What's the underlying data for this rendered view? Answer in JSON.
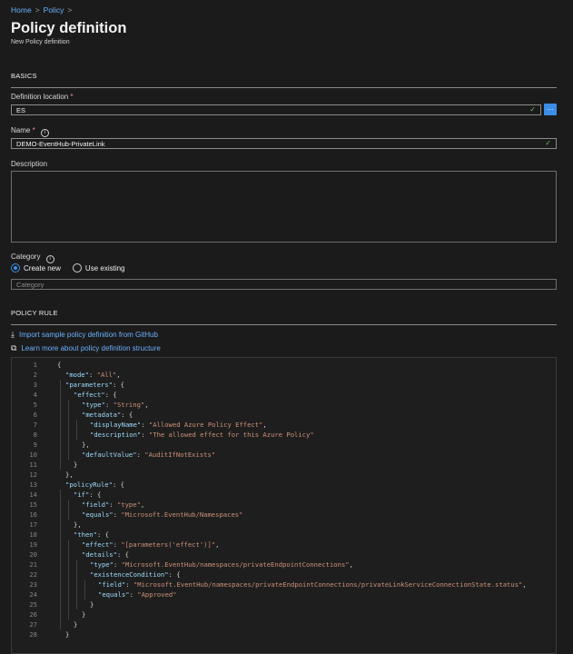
{
  "breadcrumb": {
    "home": "Home",
    "sep": ">",
    "policy": "Policy"
  },
  "header": {
    "title": "Policy definition",
    "subtitle": "New Policy definition"
  },
  "basics": {
    "section_title": "BASICS",
    "definition_location": {
      "label": "Definition location",
      "value": "ES",
      "browse_label": "..."
    },
    "name": {
      "label": "Name",
      "value": "DEMO-EventHub-PrivateLink",
      "info": "i"
    },
    "description": {
      "label": "Description",
      "value": ""
    },
    "category": {
      "label": "Category",
      "info": "i",
      "create_new": "Create new",
      "use_existing": "Use existing",
      "placeholder": "Category"
    }
  },
  "required_mark": "*",
  "valid_mark": "✓",
  "policy_rule": {
    "section_title": "POLICY RULE",
    "import_link": "Import sample policy definition from GitHub",
    "learn_link": "Learn more about policy definition structure"
  },
  "code": {
    "lines": [
      [
        [
          "p",
          "{"
        ]
      ],
      [
        [
          "k",
          "\"mode\""
        ],
        [
          "p",
          ": "
        ],
        [
          "s",
          "\"All\""
        ],
        [
          "p",
          ","
        ]
      ],
      [
        [
          "k",
          "\"parameters\""
        ],
        [
          "p",
          ": {"
        ]
      ],
      [
        [
          "k",
          "\"effect\""
        ],
        [
          "p",
          ": {"
        ]
      ],
      [
        [
          "k",
          "\"type\""
        ],
        [
          "p",
          ": "
        ],
        [
          "s",
          "\"String\""
        ],
        [
          "p",
          ","
        ]
      ],
      [
        [
          "k",
          "\"metadata\""
        ],
        [
          "p",
          ": {"
        ]
      ],
      [
        [
          "k",
          "\"displayName\""
        ],
        [
          "p",
          ": "
        ],
        [
          "s",
          "\"Allowed Azure Policy Effect\""
        ],
        [
          "p",
          ","
        ]
      ],
      [
        [
          "k",
          "\"description\""
        ],
        [
          "p",
          ": "
        ],
        [
          "s",
          "\"The allowed effect for this Azure Policy\""
        ]
      ],
      [
        [
          "p",
          "},"
        ]
      ],
      [
        [
          "k",
          "\"defaultValue\""
        ],
        [
          "p",
          ": "
        ],
        [
          "s",
          "\"AuditIfNotExists\""
        ]
      ],
      [
        [
          "p",
          "}"
        ]
      ],
      [
        [
          "p",
          "},"
        ]
      ],
      [
        [
          "k",
          "\"policyRule\""
        ],
        [
          "p",
          ": {"
        ]
      ],
      [
        [
          "k",
          "\"if\""
        ],
        [
          "p",
          ": {"
        ]
      ],
      [
        [
          "k",
          "\"field\""
        ],
        [
          "p",
          ": "
        ],
        [
          "s",
          "\"type\""
        ],
        [
          "p",
          ","
        ]
      ],
      [
        [
          "k",
          "\"equals\""
        ],
        [
          "p",
          ": "
        ],
        [
          "s",
          "\"Microsoft.EventHub/Namespaces\""
        ]
      ],
      [
        [
          "p",
          "},"
        ]
      ],
      [
        [
          "k",
          "\"then\""
        ],
        [
          "p",
          ": {"
        ]
      ],
      [
        [
          "k",
          "\"effect\""
        ],
        [
          "p",
          ": "
        ],
        [
          "s",
          "\"[parameters('effect')]\""
        ],
        [
          "p",
          ","
        ]
      ],
      [
        [
          "k",
          "\"details\""
        ],
        [
          "p",
          ": {"
        ]
      ],
      [
        [
          "k",
          "\"type\""
        ],
        [
          "p",
          ": "
        ],
        [
          "s",
          "\"Microsoft.EventHub/namespaces/privateEndpointConnections\""
        ],
        [
          "p",
          ","
        ]
      ],
      [
        [
          "k",
          "\"existenceCondition\""
        ],
        [
          "p",
          ": {"
        ]
      ],
      [
        [
          "k",
          "\"field\""
        ],
        [
          "p",
          ": "
        ],
        [
          "s",
          "\"Microsoft.EventHub/namespaces/privateEndpointConnections/privateLinkServiceConnectionState.status\""
        ],
        [
          "p",
          ","
        ]
      ],
      [
        [
          "k",
          "\"equals\""
        ],
        [
          "p",
          ": "
        ],
        [
          "s",
          "\"Approved\""
        ]
      ],
      [
        [
          "p",
          "}"
        ]
      ],
      [
        [
          "p",
          "}"
        ]
      ],
      [
        [
          "p",
          "}"
        ]
      ],
      [
        [
          "p",
          "}"
        ]
      ]
    ]
  }
}
